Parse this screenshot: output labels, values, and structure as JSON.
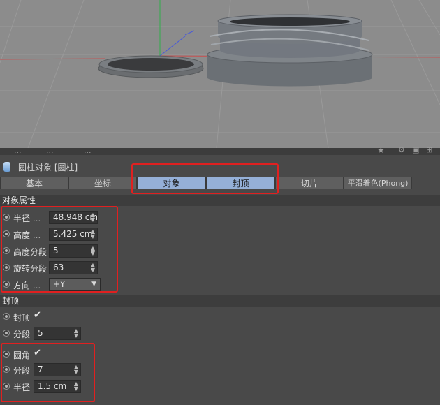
{
  "header": {
    "object_title": "圆柱对象 [圆柱]"
  },
  "toolbar_strip": {
    "fragments": [
      "...",
      "...",
      "..."
    ]
  },
  "tabs": [
    {
      "label": "基本",
      "active": false
    },
    {
      "label": "坐标",
      "active": false
    },
    {
      "label": "对象",
      "active": true
    },
    {
      "label": "封顶",
      "active": true
    },
    {
      "label": "切片",
      "active": false
    },
    {
      "label": "平滑着色(Phong)",
      "active": false
    }
  ],
  "object_section": {
    "title": "对象属性",
    "radius": {
      "label": "半径",
      "dots": "...",
      "value": "48.948 cm"
    },
    "height": {
      "label": "高度",
      "dots": "...",
      "value": "5.425 cm"
    },
    "height_segments": {
      "label": "高度分段",
      "value": "5"
    },
    "rotation_segments": {
      "label": "旋转分段",
      "value": "63"
    },
    "orientation": {
      "label": "方向",
      "dots": "...",
      "value": "+Y"
    }
  },
  "caps_section": {
    "title": "封顶",
    "caps": {
      "label": "封顶",
      "checked": true
    },
    "segments": {
      "label": "分段",
      "value": "5"
    },
    "fillet": {
      "label": "圆角",
      "checked": true
    },
    "fillet_segments": {
      "label": "分段",
      "value": "7"
    },
    "fillet_radius": {
      "label": "半径",
      "value": "1.5 cm"
    }
  },
  "colors": {
    "viewport_bg": "#8c8c8c",
    "panel_bg": "#494949",
    "active_tab": "#95b0d8",
    "highlight_box": "#e02020"
  }
}
